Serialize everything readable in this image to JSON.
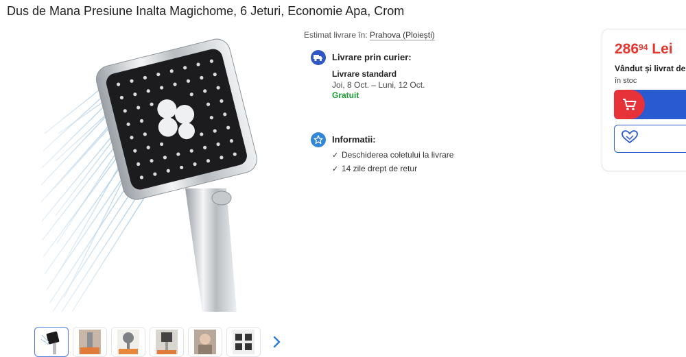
{
  "product": {
    "title": "Dus de Mana Presiune Inalta Magichome, 6 Jeturi, Economie Apa, Crom"
  },
  "gallery": {
    "thumbnail_count": 6,
    "next_icon": "chevron-right-icon"
  },
  "delivery": {
    "estimate_label": "Estimat livrare în:",
    "location": "Prahova (Ploiești)",
    "courier_title": "Livrare prin curier:",
    "standard_label": "Livrare standard",
    "dates": "Joi, 8 Oct. – Luni, 12 Oct.",
    "cost": "Gratuit",
    "icon": "truck-icon"
  },
  "info": {
    "title": "Informatii:",
    "icon": "star-icon",
    "items": [
      "Deschiderea coletului la livrare",
      "14 zile drept de retur"
    ]
  },
  "buy_box": {
    "price_int": "286",
    "price_dec": "94",
    "currency": "Lei",
    "seller_text": "Vândut și livrat de",
    "stock": "în stoc",
    "cart_icon": "cart-icon",
    "fav_icon": "heart-icon"
  },
  "colors": {
    "price": "#e6352c",
    "primary": "#2a5ad0",
    "cart_red": "#e8323a",
    "free_green": "#1a9a31"
  }
}
